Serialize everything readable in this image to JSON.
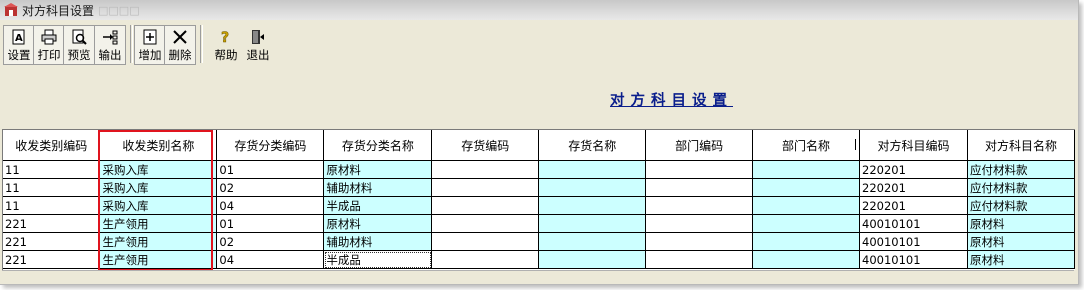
{
  "window": {
    "title": "对方科目设置",
    "title_ghost": "□□□□"
  },
  "toolbar": {
    "buttons": [
      {
        "label": "设置",
        "icon": "settings-doc-icon"
      },
      {
        "label": "打印",
        "icon": "printer-icon"
      },
      {
        "label": "预览",
        "icon": "preview-icon"
      },
      {
        "label": "输出",
        "icon": "export-icon"
      },
      {
        "label": "增加",
        "icon": "add-icon"
      },
      {
        "label": "删除",
        "icon": "delete-x-icon"
      },
      {
        "label": "帮助",
        "icon": "help-icon"
      },
      {
        "label": "退出",
        "icon": "exit-door-icon"
      }
    ]
  },
  "report": {
    "title": "对方科目设置"
  },
  "table": {
    "columns": [
      "收发类别编码",
      "收发类别名称",
      "存货分类编码",
      "存货分类名称",
      "存货编码",
      "存货名称",
      "部门编码",
      "部门名称",
      "对方科目编码",
      "对方科目名称"
    ],
    "rows": [
      [
        "11",
        "采购入库",
        "01",
        "原材料",
        "",
        "",
        "",
        "",
        "220201",
        "应付材料款"
      ],
      [
        "11",
        "采购入库",
        "02",
        "辅助材料",
        "",
        "",
        "",
        "",
        "220201",
        "应付材料款"
      ],
      [
        "11",
        "采购入库",
        "04",
        "半成品",
        "",
        "",
        "",
        "",
        "220201",
        "应付材料款"
      ],
      [
        "221",
        "生产领用",
        "01",
        "原材料",
        "",
        "",
        "",
        "",
        "40010101",
        "原材料"
      ],
      [
        "221",
        "生产领用",
        "02",
        "辅助材料",
        "",
        "",
        "",
        "",
        "40010101",
        "原材料"
      ],
      [
        "221",
        "生产领用",
        "04",
        "半成品",
        "",
        "",
        "",
        "",
        "40010101",
        "原材料"
      ]
    ]
  },
  "colors": {
    "cyan_cell": "#ccffff",
    "highlight_box": "#e0141e",
    "report_title": "#0a1e8c"
  }
}
